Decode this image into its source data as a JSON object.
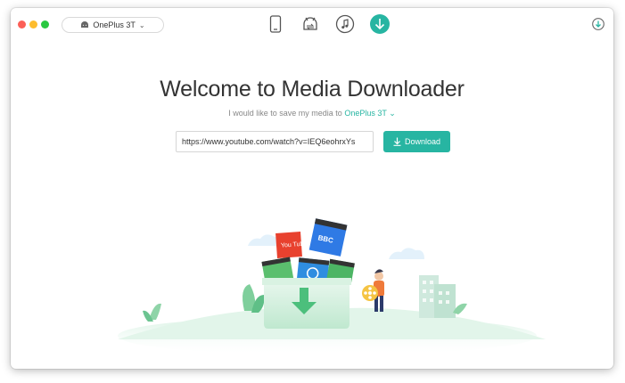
{
  "window": {
    "device_selector": {
      "label": "OnePlus 3T",
      "icon": "android-icon"
    },
    "toolbar_icons": [
      "phone-icon",
      "android-transfer-icon",
      "music-icon",
      "download-icon"
    ],
    "active_tool": "download-icon"
  },
  "main": {
    "title": "Welcome to Media Downloader",
    "subtitle_prefix": "I would like to save my media to",
    "subtitle_device": "OnePlus 3T",
    "url_value": "https://www.youtube.com/watch?v=IEQ6eohrxYs",
    "download_label": "Download"
  },
  "illustration": {
    "badges": [
      "You Tube",
      "BBC"
    ]
  },
  "colors": {
    "accent": "#27b5a2",
    "illustration_green": "#bfe8cf"
  }
}
